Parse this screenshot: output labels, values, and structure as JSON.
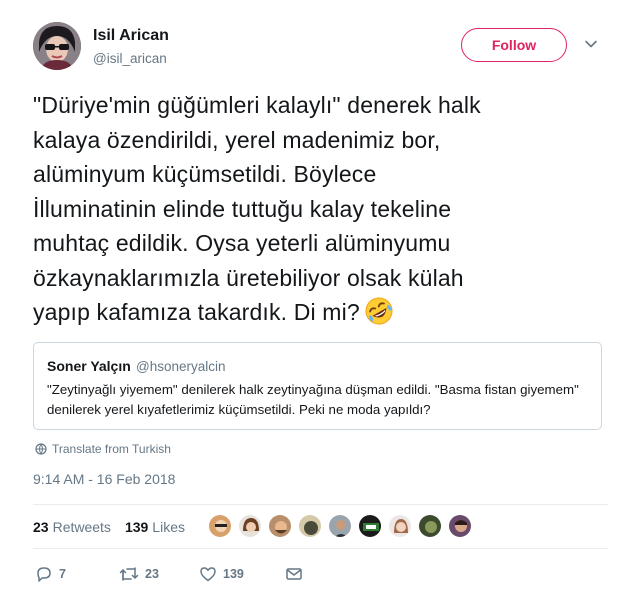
{
  "author": {
    "name": "Isil Arican",
    "handle": "@isil_arican",
    "follow_label": "Follow"
  },
  "tweet": {
    "lines": [
      "\"Düriye'min güğümleri kalaylı\" denerek halk",
      "kalaya özendirildi, yerel madenimiz bor,",
      "alüminyum küçümsetildi. Böylece",
      "İlluminatinin elinde tuttuğu kalay tekeline",
      "muhtaç edildik. Oysa yeterli alüminyumu",
      "özkaynaklarımızla üretebiliyor olsak külah",
      "yapıp kafamıza takardık. Di mi?"
    ],
    "emoji": "rolling-on-floor-laughing-emoji"
  },
  "quote": {
    "name": "Soner Yalçın",
    "handle": "@hsoneryalcin",
    "text": "\"Zeytinyağlı yiyemem\" denilerek halk zeytinyağına düşman edildi. \"Basma fistan giyemem\" denilerek yerel kıyafetlerimiz küçümsetildi. Peki ne moda yapıldı?"
  },
  "translate_label": "Translate from Turkish",
  "timestamp": "9:14 AM - 16 Feb 2018",
  "stats": {
    "retweets_count": "23",
    "retweets_label": "Retweets",
    "likes_count": "139",
    "likes_label": "Likes"
  },
  "actions": {
    "reply_count": "7",
    "retweet_count": "23",
    "like_count": "139"
  },
  "colors": {
    "accent": "#e0245e",
    "muted": "#657786",
    "border": "#ccd6dd"
  }
}
